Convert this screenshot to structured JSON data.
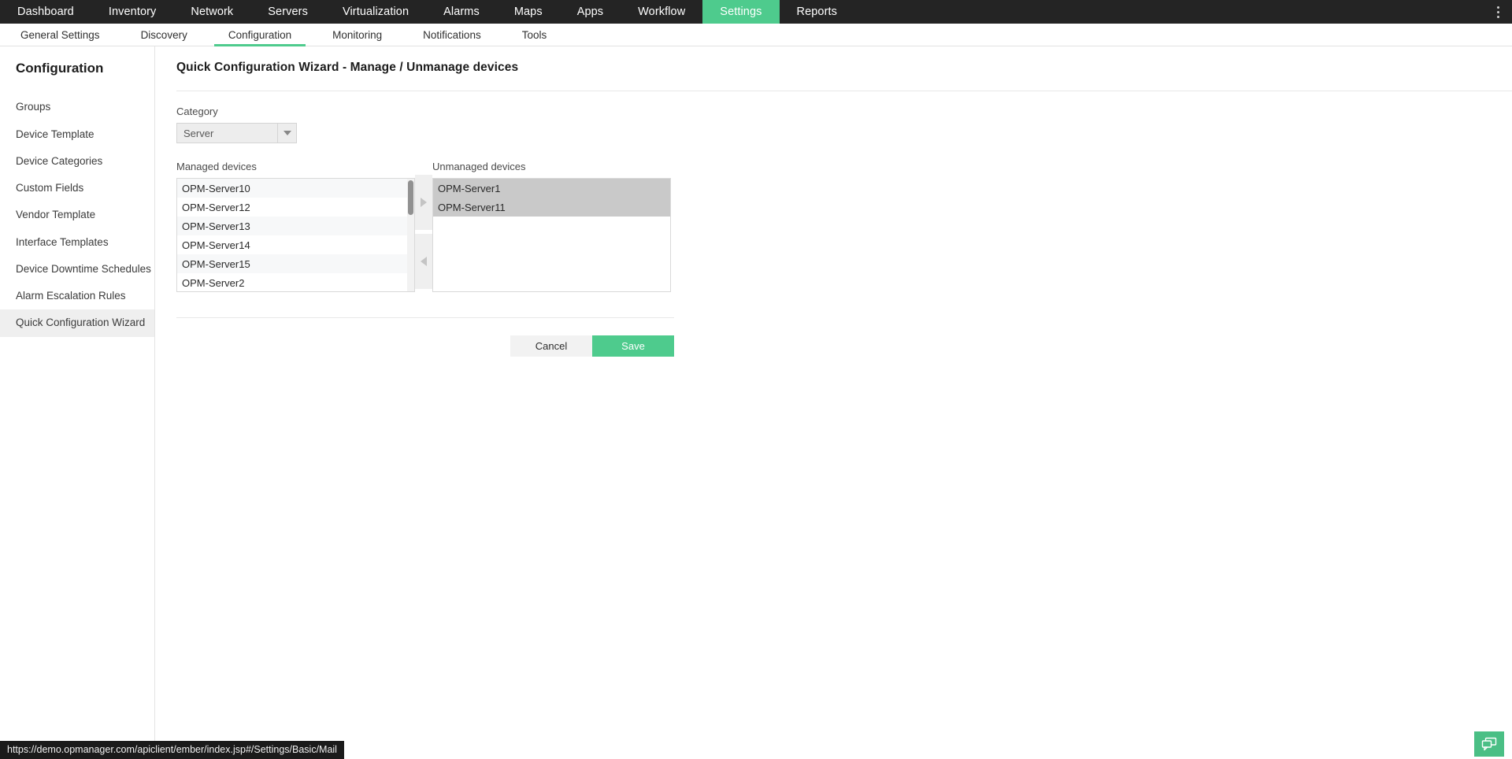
{
  "topnav": {
    "items": [
      {
        "label": "Dashboard",
        "active": false
      },
      {
        "label": "Inventory",
        "active": false
      },
      {
        "label": "Network",
        "active": false
      },
      {
        "label": "Servers",
        "active": false
      },
      {
        "label": "Virtualization",
        "active": false
      },
      {
        "label": "Alarms",
        "active": false
      },
      {
        "label": "Maps",
        "active": false
      },
      {
        "label": "Apps",
        "active": false
      },
      {
        "label": "Workflow",
        "active": false
      },
      {
        "label": "Settings",
        "active": true
      },
      {
        "label": "Reports",
        "active": false
      }
    ],
    "kebab_icon": "more-vertical-icon",
    "active_color": "#4ECB8D",
    "background": "#242424"
  },
  "subnav": {
    "items": [
      {
        "label": "General Settings",
        "active": false
      },
      {
        "label": "Discovery",
        "active": false
      },
      {
        "label": "Configuration",
        "active": true
      },
      {
        "label": "Monitoring",
        "active": false
      },
      {
        "label": "Notifications",
        "active": false
      },
      {
        "label": "Tools",
        "active": false
      }
    ],
    "indicator_color": "#4ECB8D"
  },
  "sidebar": {
    "title": "Configuration",
    "items": [
      {
        "label": "Groups",
        "active": false
      },
      {
        "label": "Device Template",
        "active": false
      },
      {
        "label": "Device Categories",
        "active": false
      },
      {
        "label": "Custom Fields",
        "active": false
      },
      {
        "label": "Vendor Template",
        "active": false
      },
      {
        "label": "Interface Templates",
        "active": false
      },
      {
        "label": "Device Downtime Schedules",
        "active": false
      },
      {
        "label": "Alarm Escalation Rules",
        "active": false
      },
      {
        "label": "Quick Configuration Wizard",
        "active": true
      }
    ]
  },
  "main": {
    "page_title": "Quick Configuration Wizard - Manage / Unmanage devices",
    "category": {
      "label": "Category",
      "value": "Server",
      "arrow_icon": "chevron-down-icon"
    },
    "managed": {
      "label": "Managed devices",
      "items": [
        {
          "name": "OPM-Server10",
          "selected": false
        },
        {
          "name": "OPM-Server12",
          "selected": false
        },
        {
          "name": "OPM-Server13",
          "selected": false
        },
        {
          "name": "OPM-Server14",
          "selected": false
        },
        {
          "name": "OPM-Server15",
          "selected": false
        },
        {
          "name": "OPM-Server2",
          "selected": false
        }
      ],
      "has_scrollbar": true
    },
    "unmanaged": {
      "label": "Unmanaged devices",
      "items": [
        {
          "name": "OPM-Server1",
          "selected": true
        },
        {
          "name": "OPM-Server11",
          "selected": true
        }
      ],
      "has_scrollbar": false,
      "selected_color": "#c9c9c9"
    },
    "transfer": {
      "to_unmanaged_icon": "triangle-right-icon",
      "to_managed_icon": "triangle-left-icon"
    },
    "actions": {
      "cancel_label": "Cancel",
      "save_label": "Save",
      "save_color": "#4ECB8D"
    }
  },
  "status_bar": {
    "url": "https://demo.opmanager.com/apiclient/ember/index.jsp#/Settings/Basic/Mail"
  },
  "chat_widget": {
    "icon": "chat-bubbles-icon",
    "color": "#4ABF85"
  }
}
